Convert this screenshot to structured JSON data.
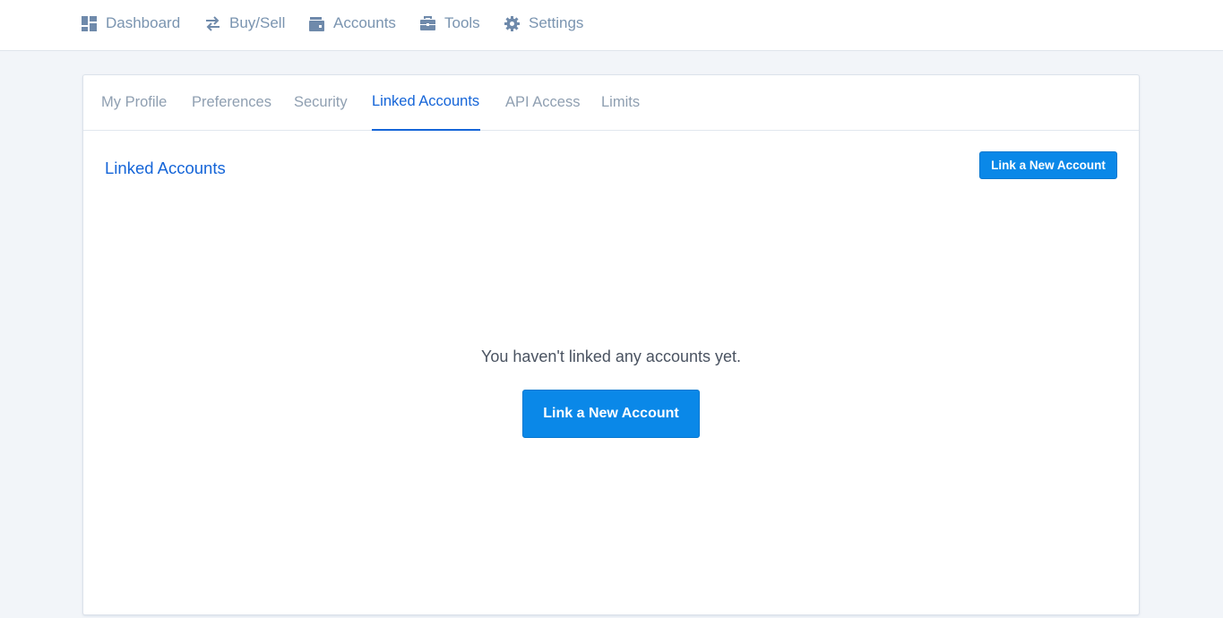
{
  "topnav": {
    "items": [
      {
        "label": "Dashboard",
        "icon": "dashboard-icon"
      },
      {
        "label": "Buy/Sell",
        "icon": "swap-arrows-icon"
      },
      {
        "label": "Accounts",
        "icon": "wallet-icon"
      },
      {
        "label": "Tools",
        "icon": "briefcase-icon"
      },
      {
        "label": "Settings",
        "icon": "gear-icon"
      }
    ]
  },
  "tabs": [
    {
      "label": "My Profile"
    },
    {
      "label": "Preferences"
    },
    {
      "label": "Security"
    },
    {
      "label": "Linked Accounts",
      "active": true
    },
    {
      "label": "API Access"
    },
    {
      "label": "Limits"
    }
  ],
  "section": {
    "title": "Linked Accounts",
    "header_button": "Link a New Account",
    "empty_message": "You haven't linked any accounts yet.",
    "empty_button": "Link a New Account"
  },
  "colors": {
    "accent": "#1565d8",
    "button": "#0a88e8",
    "nav_text": "#7a94b0"
  }
}
